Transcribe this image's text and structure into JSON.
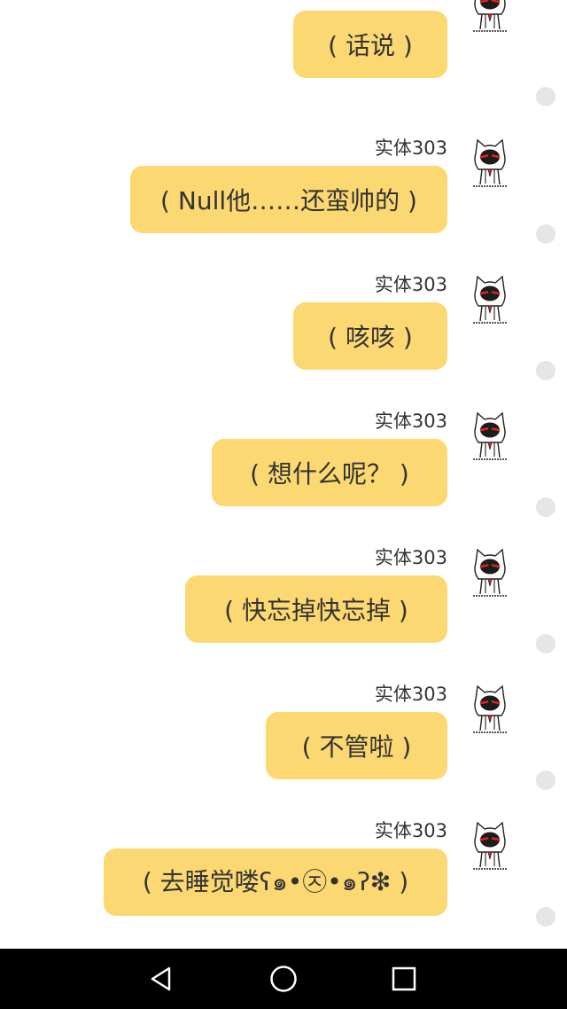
{
  "messages": [
    {
      "sender": "",
      "text": "( 话说 )"
    },
    {
      "sender": "实体303",
      "text": "( Null他……还蛮帅的 )"
    },
    {
      "sender": "实体303",
      "text": "( 咳咳 )"
    },
    {
      "sender": "实体303",
      "text": "( 想什么呢？ )"
    },
    {
      "sender": "实体303",
      "text": "( 快忘掉快忘掉 )"
    },
    {
      "sender": "实体303",
      "text": "( 不管啦 )"
    },
    {
      "sender": "实体303",
      "text": "( 去睡觉喽ʕ๑•㉨•๑ʔ❇ )"
    }
  ],
  "colors": {
    "bubble": "#fbd871",
    "text": "#333333",
    "status_dot": "#e6e6e6",
    "navbar": "#000000"
  },
  "icons": {
    "avatar": "cartoon-character-avatar-icon",
    "nav_back": "back-triangle-icon",
    "nav_home": "home-circle-icon",
    "nav_recents": "recents-square-icon"
  }
}
